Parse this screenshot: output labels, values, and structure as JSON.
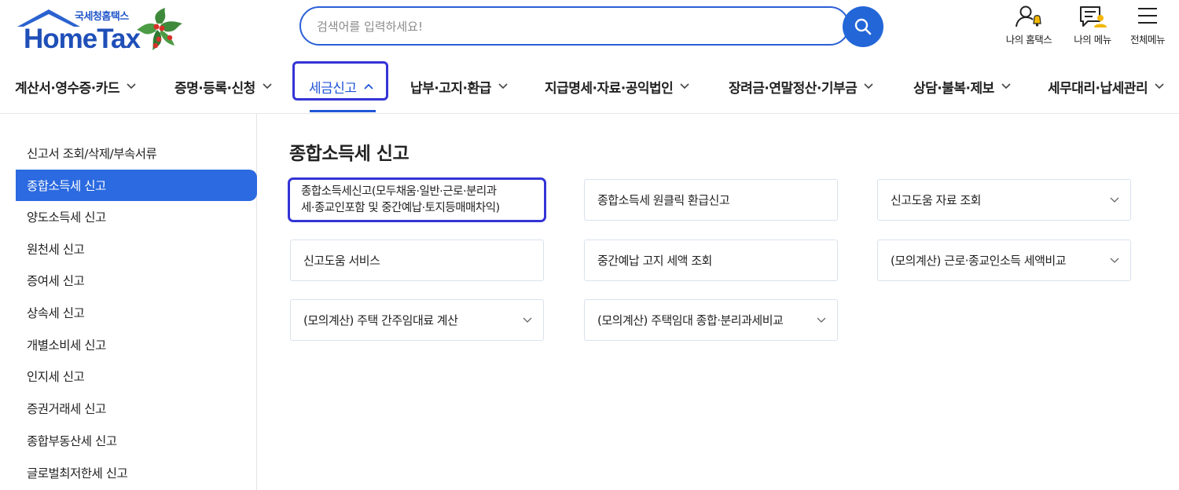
{
  "header": {
    "logo_sub": "국세청홈택스",
    "logo_main": "HomeTax",
    "search_placeholder": "검색어를 입력하세요!",
    "utils": [
      {
        "label": "나의 홈택스",
        "icon": "user-bell-icon"
      },
      {
        "label": "나의 메뉴",
        "icon": "menu-user-icon"
      },
      {
        "label": "전체메뉴",
        "icon": "hamburger-icon"
      }
    ]
  },
  "nav": [
    {
      "label": "계산서·영수증·카드"
    },
    {
      "label": "증명·등록·신청"
    },
    {
      "label": "세금신고"
    },
    {
      "label": "납부·고지·환급"
    },
    {
      "label": "지급명세·자료·공익법인"
    },
    {
      "label": "장려금·연말정산·기부금"
    },
    {
      "label": "상담·불복·제보"
    },
    {
      "label": "세무대리·납세관리"
    }
  ],
  "sidebar": [
    {
      "label": "신고서 조회/삭제/부속서류"
    },
    {
      "label": "종합소득세 신고"
    },
    {
      "label": "양도소득세 신고"
    },
    {
      "label": "원천세 신고"
    },
    {
      "label": "증여세 신고"
    },
    {
      "label": "상속세 신고"
    },
    {
      "label": "개별소비세 신고"
    },
    {
      "label": "인지세 신고"
    },
    {
      "label": "증권거래세 신고"
    },
    {
      "label": "종합부동산세 신고"
    },
    {
      "label": "글로벌최저한세 신고"
    }
  ],
  "main": {
    "title": "종합소득세 신고",
    "cards": [
      {
        "line1": "종합소득세신고(모두채움·일반·근로·분리과",
        "line2": "세·종교인포함 및 중간예납·토지등매매차익)"
      },
      {
        "label": "종합소득세 원클릭 환급신고"
      },
      {
        "label": "신고도움 자료 조회"
      },
      {
        "label": "신고도움 서비스"
      },
      {
        "label": "중간예납 고지 세액 조회"
      },
      {
        "label": "(모의계산) 근로·종교인소득 세액비교"
      },
      {
        "label": "(모의계산) 주택 간주임대료 계산"
      },
      {
        "label": "(모의계산) 주택임대 종합·분리과세비교"
      }
    ]
  },
  "colors": {
    "accent": "#2b6ae0",
    "highlight": "#3434d6",
    "brand": "#1f4fb8"
  }
}
